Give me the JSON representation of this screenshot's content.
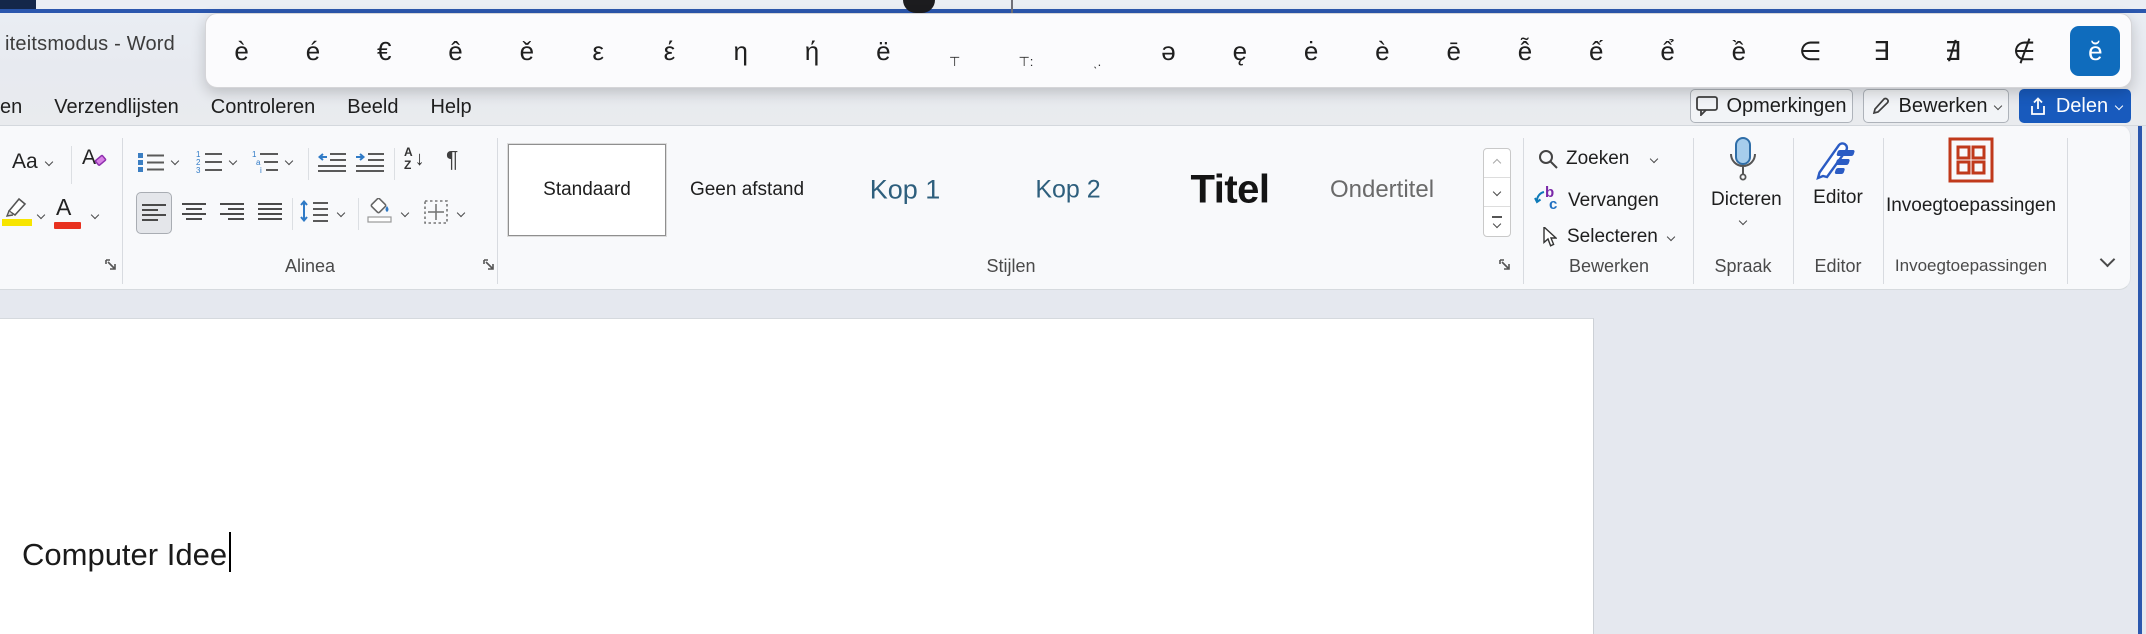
{
  "window_title": "iteitsmodus  -  Word",
  "char_picker": {
    "items": [
      {
        "ch": "è"
      },
      {
        "ch": "é"
      },
      {
        "ch": "€"
      },
      {
        "ch": "ê"
      },
      {
        "ch": "ě"
      },
      {
        "ch": "ε"
      },
      {
        "ch": "έ"
      },
      {
        "ch": "η"
      },
      {
        "ch": "ή"
      },
      {
        "ch": "ë"
      },
      {
        "ch": "⊤",
        "small": true
      },
      {
        "ch": "⊤:",
        "small": true
      },
      {
        "ch": "ˎ.",
        "small": true
      },
      {
        "ch": "ə"
      },
      {
        "ch": "ę"
      },
      {
        "ch": "ė"
      },
      {
        "ch": "ѐ"
      },
      {
        "ch": "ē"
      },
      {
        "ch": "ễ"
      },
      {
        "ch": "ế"
      },
      {
        "ch": "ể"
      },
      {
        "ch": "ề"
      },
      {
        "ch": "∈"
      },
      {
        "ch": "∃"
      },
      {
        "ch": "∄"
      },
      {
        "ch": "∉"
      },
      {
        "ch": "ĕ",
        "selected": true
      }
    ]
  },
  "tabs": [
    "en",
    "Verzendlijsten",
    "Controleren",
    "Beeld",
    "Help"
  ],
  "top_buttons": {
    "comments": "Opmerkingen",
    "editing_mode": "Bewerken",
    "share": "Delen"
  },
  "ribbon": {
    "font_group": {
      "change_case": "Aa",
      "clear_format_letter": "A",
      "font_color_letter": "A"
    },
    "paragraph_group": {
      "label": "Alinea",
      "sort_a": "A",
      "sort_z": "Z",
      "pilcrow": "¶"
    },
    "styles_group": {
      "label": "Stijlen",
      "items": [
        {
          "label": "Standaard",
          "style_key": "standaard",
          "selected": true
        },
        {
          "label": "Geen afstand",
          "style_key": "geen-afstand"
        },
        {
          "label": "Kop 1",
          "style_key": "kop1"
        },
        {
          "label": "Kop 2",
          "style_key": "kop2"
        },
        {
          "label": "Titel",
          "style_key": "titel"
        },
        {
          "label": "Ondertitel",
          "style_key": "ondertitel"
        }
      ]
    },
    "editing_group": {
      "label": "Bewerken",
      "find": "Zoeken",
      "replace": "Vervangen",
      "select": "Selecteren",
      "replace_b": "b",
      "replace_c": "c"
    },
    "speech_group": {
      "label": "Spraak",
      "dictate": "Dicteren"
    },
    "editor_group": {
      "label": "Editor",
      "button": "Editor"
    },
    "addins_group": {
      "label": "Invoegtoepassingen",
      "button": "Invoegtoepassingen"
    }
  },
  "document": {
    "text": "Computer Idee"
  },
  "colors": {
    "accent_blue": "#2b57ae",
    "selected_char_bg": "#0f6cbd",
    "share_button_bg": "#185abd",
    "heading_color": "#2e5f7d",
    "highlight_yellow": "#f7e500",
    "font_color_red": "#e8311f",
    "addins_icon": "#c0391b"
  }
}
